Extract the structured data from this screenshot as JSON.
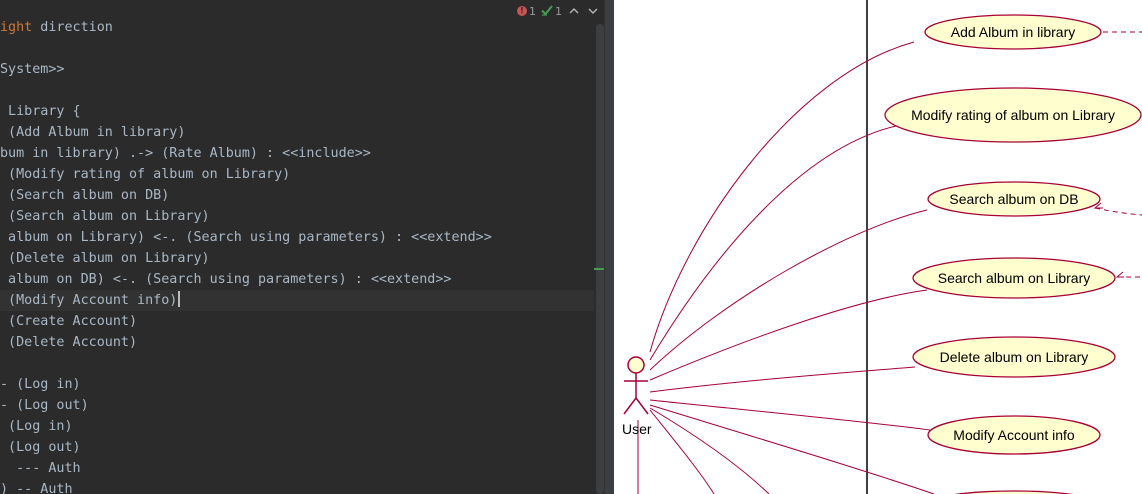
{
  "editor": {
    "lines": [
      {
        "before": "",
        "keyword": "ight",
        "after": " direction"
      },
      {
        "before": "",
        "keyword": "",
        "after": ""
      },
      {
        "before": "System>>",
        "keyword": "",
        "after": ""
      },
      {
        "before": "",
        "keyword": "",
        "after": ""
      },
      {
        "before": " Library {",
        "keyword": "",
        "after": ""
      },
      {
        "before": " (Add Album in library)",
        "keyword": "",
        "after": ""
      },
      {
        "before": "bum in library) .-> (Rate Album) : <<include>>",
        "keyword": "",
        "after": ""
      },
      {
        "before": " (Modify rating of album on Library)",
        "keyword": "",
        "after": ""
      },
      {
        "before": " (Search album on DB)",
        "keyword": "",
        "after": ""
      },
      {
        "before": " (Search album on Library)",
        "keyword": "",
        "after": ""
      },
      {
        "before": " album on Library) <-. (Search using parameters) : <<extend>>",
        "keyword": "",
        "after": ""
      },
      {
        "before": " (Delete album on Library)",
        "keyword": "",
        "after": ""
      },
      {
        "before": " album on DB) <-. (Search using parameters) : <<extend>>",
        "keyword": "",
        "after": ""
      },
      {
        "before": " (Modify Account info)",
        "keyword": "",
        "after": ""
      },
      {
        "before": " (Create Account)",
        "keyword": "",
        "after": ""
      },
      {
        "before": " (Delete Account)",
        "keyword": "",
        "after": ""
      },
      {
        "before": "",
        "keyword": "",
        "after": ""
      },
      {
        "before": "- (Log in)",
        "keyword": "",
        "after": ""
      },
      {
        "before": "- (Log out)",
        "keyword": "",
        "after": ""
      },
      {
        "before": " (Log in)",
        "keyword": "",
        "after": ""
      },
      {
        "before": " (Log out)",
        "keyword": "",
        "after": ""
      },
      {
        "before": "  --- Auth",
        "keyword": "",
        "after": ""
      },
      {
        "before": ") -- Auth",
        "keyword": "",
        "after": ""
      }
    ],
    "current_line_index": 13,
    "status": {
      "errors": "1",
      "warnings": "1"
    }
  },
  "diagram": {
    "actor_label": "User",
    "usecases": [
      "Add Album in library",
      "Modify rating of album on Library",
      "Search album on DB",
      "Search album on Library",
      "Delete album on Library",
      "Modify Account info"
    ]
  },
  "colors": {
    "editor_bg": "#2b2b2b",
    "editor_text": "#a9b7c6",
    "keyword": "#cc7832",
    "current_line": "#323232",
    "error": "#c75450",
    "ok": "#499c54",
    "usecase_fill": "#fefece",
    "diagram_stroke": "#a80036"
  },
  "icons": {
    "error": "error-icon",
    "ok": "inspection-ok-icon",
    "prev": "chevron-up-icon",
    "next": "chevron-down-icon"
  }
}
